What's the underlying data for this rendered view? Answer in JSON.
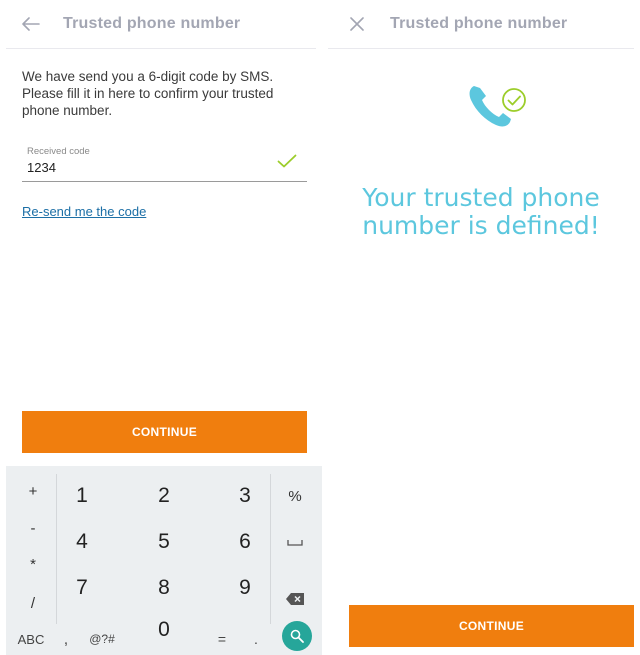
{
  "left_screen": {
    "title": "Trusted phone number",
    "nav_icon": "back-arrow-icon",
    "instructions": "We have send you a 6-digit code by SMS. Please fill it in here to confirm your trusted phone number.",
    "code_field": {
      "label": "Received code",
      "value": "1234"
    },
    "resend_link": "Re-send me the code",
    "continue_label": "CONTINUE"
  },
  "keyboard": {
    "left_column": [
      "+",
      "-",
      "*",
      "/"
    ],
    "digits": [
      "1",
      "2",
      "3",
      "4",
      "5",
      "6",
      "7",
      "8",
      "9",
      "0"
    ],
    "right_column": [
      "%",
      "space-icon",
      "backspace-icon",
      "search-icon"
    ],
    "bottom_row": {
      "abc": "ABC",
      "comma": ",",
      "symbols": "@?#",
      "equals": "=",
      "period": "."
    }
  },
  "right_screen": {
    "title": "Trusted phone number",
    "nav_icon": "close-icon",
    "success_message_line1": "Your trusted phone",
    "success_message_line2": "number is defined!",
    "continue_label": "CONTINUE"
  },
  "colors": {
    "accent_orange": "#f07e0e",
    "success_cyan": "#5cc7de",
    "check_green": "#9ccd2a",
    "link_blue": "#1c6fa6",
    "title_gray": "#a3a6b3"
  }
}
